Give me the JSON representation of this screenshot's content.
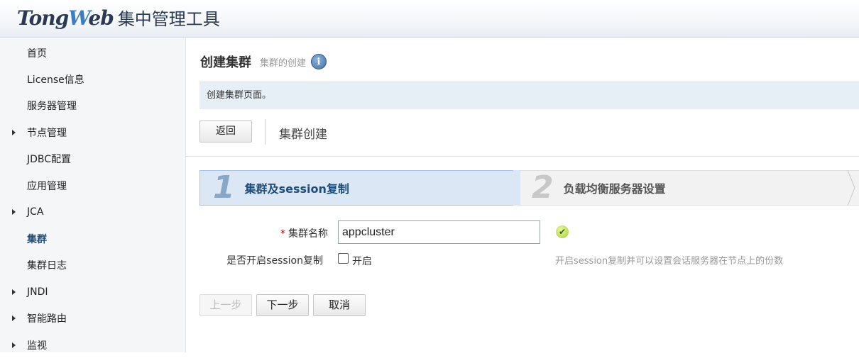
{
  "header": {
    "brand_a": "Tong",
    "brand_w": "W",
    "brand_b": "eb",
    "subtitle": "集中管理工具"
  },
  "sidebar": {
    "items": [
      {
        "label": "首页",
        "expandable": false,
        "active": false
      },
      {
        "label": "License信息",
        "expandable": false,
        "active": false
      },
      {
        "label": "服务器管理",
        "expandable": false,
        "active": false
      },
      {
        "label": "节点管理",
        "expandable": true,
        "active": false
      },
      {
        "label": "JDBC配置",
        "expandable": false,
        "active": false
      },
      {
        "label": "应用管理",
        "expandable": false,
        "active": false
      },
      {
        "label": "JCA",
        "expandable": true,
        "active": false
      },
      {
        "label": "集群",
        "expandable": false,
        "active": true
      },
      {
        "label": "集群日志",
        "expandable": false,
        "active": false
      },
      {
        "label": "JNDI",
        "expandable": true,
        "active": false
      },
      {
        "label": "智能路由",
        "expandable": true,
        "active": false
      },
      {
        "label": "监视",
        "expandable": true,
        "active": false
      }
    ]
  },
  "page": {
    "title": "创建集群",
    "subtitle": "集群的创建",
    "info_icon": "i",
    "notice": "创建集群页面。",
    "back_label": "返回",
    "section_title": "集群创建"
  },
  "wizard": {
    "steps": [
      {
        "num": "1",
        "label": "集群及session复制",
        "active": true
      },
      {
        "num": "2",
        "label": "负载均衡服务器设置",
        "active": false
      }
    ]
  },
  "form": {
    "required_mark": "*",
    "cluster_name_label": "集群名称",
    "cluster_name_value": "appcluster",
    "valid_icon": "✔",
    "session_label": "是否开启session复制",
    "session_checkbox_label": "开启",
    "session_checked": false,
    "session_hint": "开启session复制并可以设置会话服务器在节点上的份数"
  },
  "actions": {
    "prev": "上一步",
    "next": "下一步",
    "cancel": "取消"
  },
  "colors": {
    "accent": "#1f4d7a",
    "step_active_bg": "#dbe7f5",
    "notice_bg": "#e6eef6",
    "required": "#cc0000"
  }
}
